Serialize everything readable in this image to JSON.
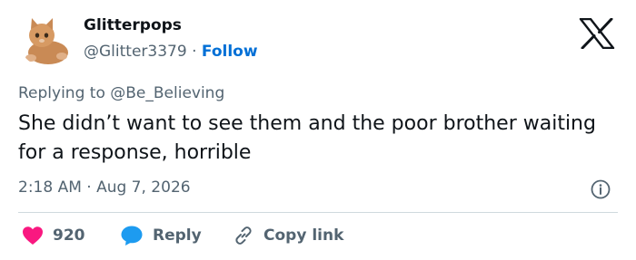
{
  "tweet": {
    "author_name": "Glitterpops",
    "author_handle": "@Glitter3379",
    "separator": "·",
    "follow_label": "Follow",
    "replying_prefix": "Replying to",
    "replying_to": "@Be_Believing",
    "text": "She didn’t want to see them and the poor brother waiting for a response, horrible",
    "timestamp": "2:18 AM · Aug 7, 2026"
  },
  "actions": {
    "like_count": "920",
    "reply_label": "Reply",
    "copy_link_label": "Copy link"
  },
  "icons": {
    "avatar": "cat-avatar",
    "logo": "x-logo-icon",
    "info": "info-icon",
    "like": "heart-icon",
    "reply": "chat-bubble-icon",
    "copy": "link-icon"
  },
  "colors": {
    "like": "#f91880",
    "reply": "#1d9bf0",
    "follow": "#006fd6",
    "secondary_text": "#536471",
    "primary_text": "#0f1419"
  }
}
